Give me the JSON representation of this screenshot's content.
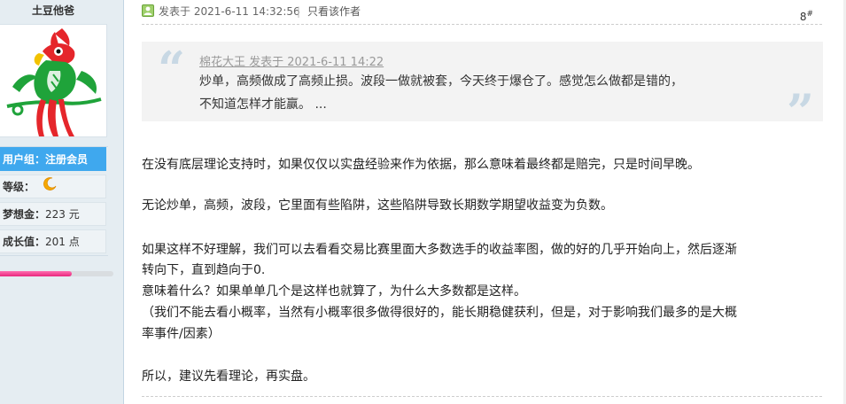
{
  "user": {
    "name": "土豆他爸",
    "group_label": "用户组：注册会员",
    "level_label": "等级：",
    "points_label": "梦想金：",
    "points_value": "223 元",
    "growth_label": "成长值：",
    "growth_value": "201 点",
    "progress_fraction": 0.63,
    "avatar_icon": "parrot-avatar",
    "level_icon": "moon-icon"
  },
  "post": {
    "status_icon": "online-status-icon",
    "posted": "发表于 2021-6-11 14:32:56",
    "separator": "|",
    "only_author": "只看该作者",
    "floor_number": "8",
    "floor_mark": "#",
    "quote": {
      "cite": "棉花大王 发表于 2021-6-11 14:22",
      "line1": "炒单，高频做成了高频止损。波段一做就被套，今天终于爆仓了。感觉怎么做都是错的，",
      "line2": "不知道怎样才能赢。 ..."
    },
    "paragraphs": [
      "在没有底层理论支持时，如果仅仅以实盘经验来作为依据，那么意味着最终都是赔完，只是时间早晚。",
      "无论炒单，高频，波段，它里面有些陷阱，这些陷阱导致长期数学期望收益变为负数。",
      "如果这样不好理解，我们可以去看看交易比赛里面大多数选手的收益率图，做的好的几乎开始向上，然后逐渐",
      "转向下，直到趋向于0.",
      "意味着什么？如果单单几个是这样也就算了，为什么大多数都是这样。",
      "（我们不能去看小概率，当然有小概率很多做得很好的，能长期稳健获利，但是，对于影响我们最多的是大概",
      "率事件/因素）",
      "所以，建议先看理论，再实盘。"
    ]
  },
  "colors": {
    "sidebar_bg": "#e5edf2",
    "group_bg": "#3fa8ee",
    "progress_fill": "#e8277e",
    "quote_bg": "#f3f3f3"
  }
}
